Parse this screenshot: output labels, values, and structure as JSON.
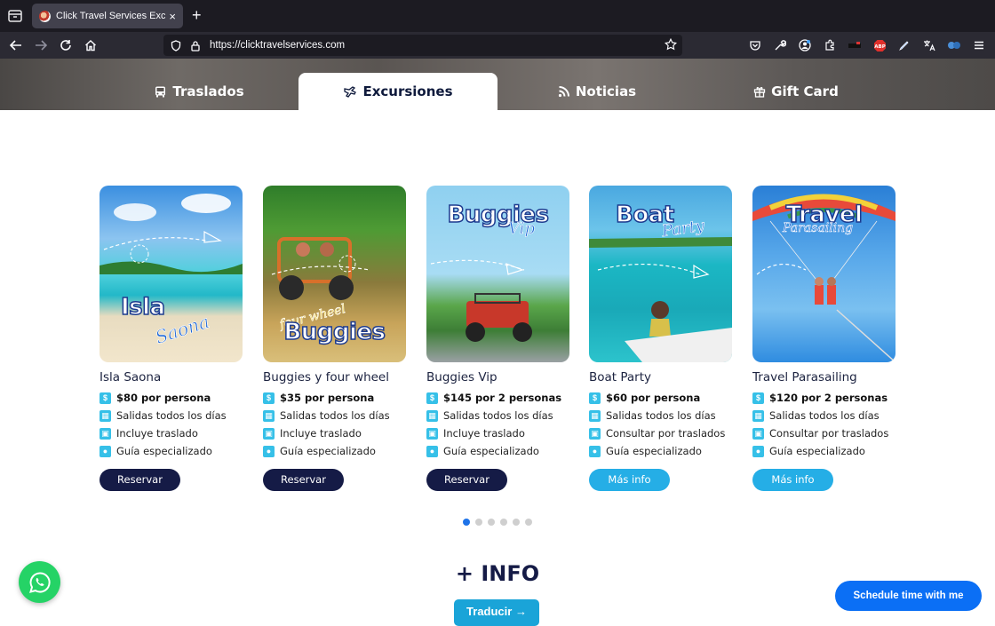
{
  "browser": {
    "tab_title": "Click Travel Services Excursiones",
    "tab_close": "×",
    "new_tab": "+",
    "url": "https://clicktravelservices.com"
  },
  "site_tabs": [
    {
      "label": "Traslados",
      "icon": "bus-icon",
      "active": false
    },
    {
      "label": "Excursiones",
      "icon": "excursion-icon",
      "active": true
    },
    {
      "label": "Noticias",
      "icon": "rss-icon",
      "active": false
    },
    {
      "label": "Gift Card",
      "icon": "gift-icon",
      "active": false
    }
  ],
  "cards": [
    {
      "img_big": "Isla",
      "img_script": "Saona",
      "name": "Isla Saona",
      "price": "$80 por persona",
      "f1": "Salidas todos los días",
      "f2": "Incluye traslado",
      "f3": "Guía especializado",
      "button": "Reservar",
      "button_style": "dark"
    },
    {
      "img_big": "Buggies",
      "img_script": "four wheel",
      "name": "Buggies y four wheel",
      "price": "$35 por persona",
      "f1": "Salidas todos los días",
      "f2": "Incluye traslado",
      "f3": "Guía especializado",
      "button": "Reservar",
      "button_style": "dark"
    },
    {
      "img_big": "Buggies",
      "img_script": "Vip",
      "name": "Buggies Vip",
      "price": "$145 por 2 personas",
      "f1": "Salidas todos los días",
      "f2": "Incluye traslado",
      "f3": "Guía especializado",
      "button": "Reservar",
      "button_style": "dark"
    },
    {
      "img_big": "Boat",
      "img_script": "Party",
      "name": "Boat Party",
      "price": "$60 por persona",
      "f1": "Salidas todos los días",
      "f2": "Consultar por traslados",
      "f3": "Guía especializado",
      "button": "Más info",
      "button_style": "light"
    },
    {
      "img_big": "Travel",
      "img_script": "Parasailing",
      "name": "Travel Parasailing",
      "price": "$120 por 2 personas",
      "f1": "Salidas todos los días",
      "f2": "Consultar por traslados",
      "f3": "Guía especializado",
      "button": "Más info",
      "button_style": "light"
    }
  ],
  "pagination": {
    "total": 6,
    "active": 1
  },
  "info_heading": "+ INFO",
  "translate_button": "Traducir →",
  "schedule_button": "Schedule time with me",
  "colors": {
    "dark_button": "#151b46",
    "light_button": "#25aee6",
    "feature_icon": "#36c0e8",
    "dot_active": "#1e73e8",
    "whatsapp": "#25d366",
    "schedule": "#0b6ff5"
  }
}
